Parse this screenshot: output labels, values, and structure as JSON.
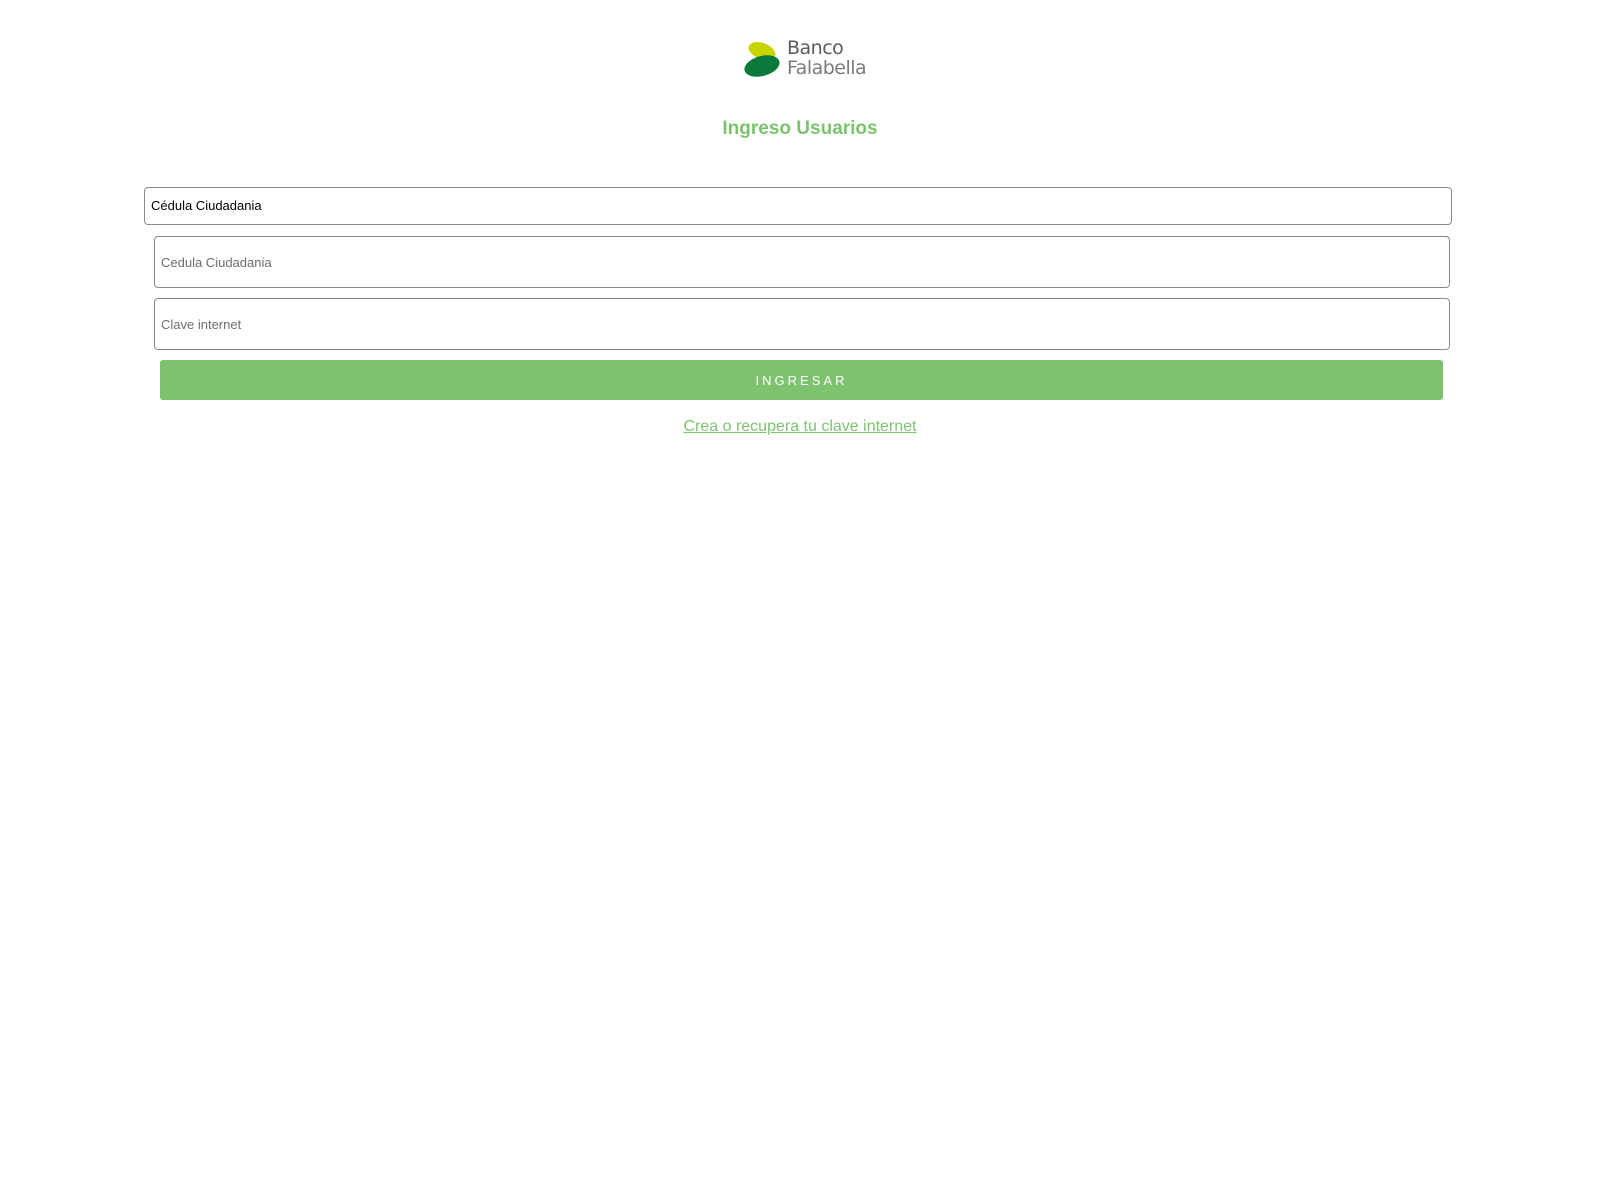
{
  "brand": {
    "name_line1": "Banco",
    "name_line2": "Falabella",
    "leaf_top_color": "#c8d400",
    "leaf_bottom_color": "#0a7a3a"
  },
  "title": "Ingreso Usuarios",
  "document_type": {
    "selected": "Cédula Ciudadania"
  },
  "form": {
    "id_placeholder": "Cedula Ciudadania",
    "id_value": "",
    "password_placeholder": "Clave internet",
    "password_value": "",
    "submit_label": "INGRESAR"
  },
  "recover_link": "Crea o recupera tu clave internet",
  "colors": {
    "accent": "#7dc36f",
    "text_gray": "#5b5b5b"
  }
}
